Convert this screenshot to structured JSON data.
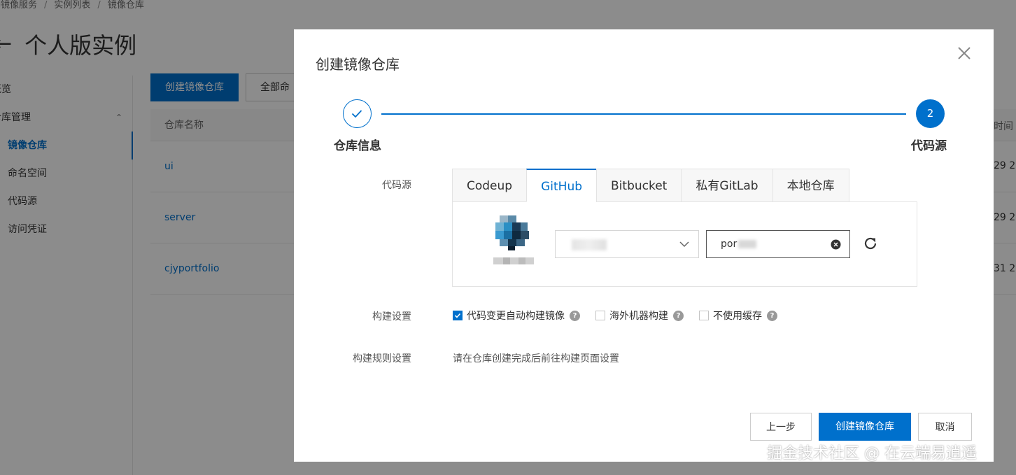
{
  "background": {
    "breadcrumb": [
      "器镜像服务",
      "实例列表",
      "镜像仓库"
    ],
    "page_title": "个人版实例",
    "sidebar": {
      "overview": "概览",
      "repo_management": "仓库管理",
      "items": [
        "镜像仓库",
        "命名空间",
        "代码源",
        "访问凭证"
      ]
    },
    "toolbar": {
      "create_button": "创建镜像仓库",
      "filter_button": "全部命"
    },
    "table": {
      "column_name": "仓库名称",
      "column_time": "时间",
      "rows": [
        {
          "name": "ui",
          "time": "29 2"
        },
        {
          "name": "server",
          "time": "29 2"
        },
        {
          "name": "cjyportfolio",
          "time": "31 2"
        }
      ]
    }
  },
  "dialog": {
    "title": "创建镜像仓库",
    "steps": [
      {
        "label": "仓库信息",
        "state": "done"
      },
      {
        "label": "代码源",
        "state": "current",
        "number": "2"
      }
    ],
    "source_label": "代码源",
    "tabs": [
      "Codeup",
      "GitHub",
      "Bitbucket",
      "私有GitLab",
      "本地仓库"
    ],
    "active_tab": "GitHub",
    "repo_input_value": "por",
    "build_settings_label": "构建设置",
    "build_options": [
      {
        "label": "代码变更自动构建镜像",
        "checked": true
      },
      {
        "label": "海外机器构建",
        "checked": false
      },
      {
        "label": "不使用缓存",
        "checked": false
      }
    ],
    "build_rules_label": "构建规则设置",
    "build_rules_hint": "请在仓库创建完成后前往构建页面设置",
    "buttons": {
      "prev": "上一步",
      "create": "创建镜像仓库",
      "cancel": "取消"
    }
  },
  "watermark": "掘金技术社区 @ 在云端易逍遥",
  "colors": {
    "primary": "#0070cc",
    "overlay": "rgba(0,0,0,0.45)"
  }
}
